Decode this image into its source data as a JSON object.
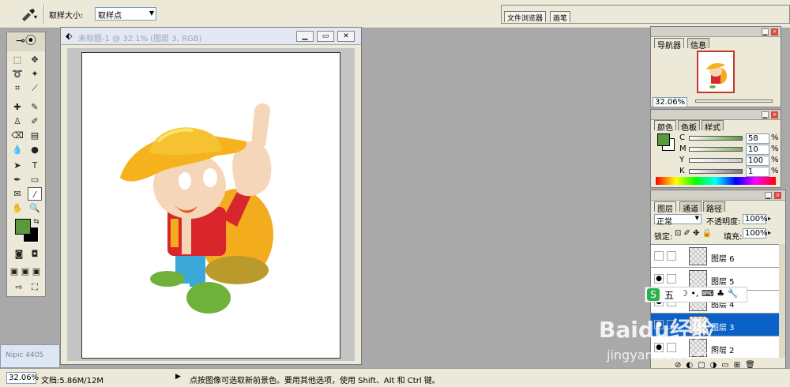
{
  "options_bar": {
    "sample_size_label": "取样大小:",
    "sample_size_value": "取样点"
  },
  "palette_well": {
    "tabs": [
      "文件浏览器",
      "画笔"
    ]
  },
  "document": {
    "title": "未标题-1 @ 32.1% (图层 3, RGB)",
    "minimized_doc_label": "Nipic 4405"
  },
  "status_bar": {
    "zoom": "32.06%",
    "doc_info": "文档:5.86M/12M",
    "hint": "点按图像可选取新前景色。要用其他选项，使用 Shift、Alt 和 Ctrl 键。"
  },
  "navigator": {
    "tabs": [
      "导航器",
      "信息"
    ],
    "zoom": "32.06%"
  },
  "color_panel": {
    "tabs": [
      "颜色",
      "色板",
      "样式"
    ],
    "channels": [
      {
        "label": "C",
        "value": "58",
        "unit": "%",
        "color": "#5b9a3c"
      },
      {
        "label": "M",
        "value": "10",
        "unit": "%",
        "color": "#8a6"
      },
      {
        "label": "Y",
        "value": "100",
        "unit": "%",
        "color": "#ccc"
      },
      {
        "label": "K",
        "value": "1",
        "unit": "%",
        "color": "#777"
      }
    ],
    "foreground_color": "#5b9a3c"
  },
  "layers_panel": {
    "tabs": [
      "图层",
      "通道",
      "路径"
    ],
    "blend_mode": "正常",
    "opacity_label": "不透明度:",
    "opacity_value": "100%",
    "lock_label": "锁定:",
    "fill_label": "填充:",
    "fill_value": "100%",
    "layers": [
      {
        "name": "图层 6",
        "visible": false,
        "selected": false
      },
      {
        "name": "图层 5",
        "visible": true,
        "selected": false
      },
      {
        "name": "图层 4",
        "visible": true,
        "selected": false
      },
      {
        "name": "图层 3",
        "visible": true,
        "selected": true
      },
      {
        "name": "图层 2",
        "visible": true,
        "selected": false
      }
    ]
  },
  "ime_bar": {
    "label": "五"
  },
  "watermark": {
    "brand": "Baidu经验",
    "url": "jingyan.baidu.com"
  },
  "colors": {
    "accent": "#0a62c8",
    "close": "#d64b3b",
    "hat": "#f5b21c",
    "shirt": "#d9262c",
    "pants": "#3aa8d8",
    "shoes": "#6fb13a",
    "skin": "#f6d6b8"
  }
}
